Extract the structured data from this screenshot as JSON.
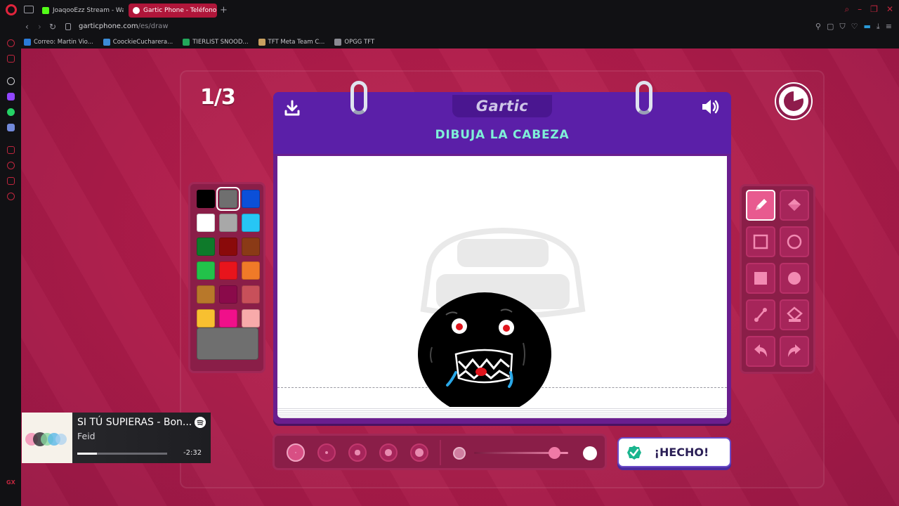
{
  "browser": {
    "tabs": [
      {
        "label": "JoaqooEzz Stream - Watc",
        "active": false,
        "icon": "kick-icon",
        "color": "#53fc18"
      },
      {
        "label": "Gartic Phone - Teléfono D",
        "active": true,
        "icon": "gartic-icon",
        "color": "#e0243c"
      }
    ],
    "url_host": "garticphone.com",
    "url_path": "/es/draw",
    "bookmarks": [
      {
        "label": "Correo: Martin Vio...",
        "icon": "outlook-icon",
        "color": "#2a7ad8"
      },
      {
        "label": "CoockieCucharera...",
        "icon": "bookmark-l-icon",
        "color": "#3b8bd6"
      },
      {
        "label": "TIERLIST SNOOD...",
        "icon": "sheets-icon",
        "color": "#22a65a"
      },
      {
        "label": "TFT Meta Team C...",
        "icon": "tft-icon",
        "color": "#c8a060"
      },
      {
        "label": "OPGG TFT",
        "icon": "opgg-icon",
        "color": "#8a8a92"
      }
    ],
    "accent": "#e0243c"
  },
  "game": {
    "round": "1/3",
    "logo": "Gartic",
    "instruction": "DIBUJA LA CABEZA",
    "colors": {
      "background": "#b01c4a",
      "notebook_header": "#5b1fa8",
      "instruction": "#7ff0d8",
      "panel": "#8a1e48"
    },
    "palette": [
      "#000000",
      "#6f6f6f",
      "#0b4fd8",
      "#ffffff",
      "#a8a8a8",
      "#27c6f5",
      "#0e7a2a",
      "#8a0a0a",
      "#8a3a16",
      "#22c24a",
      "#e8141c",
      "#f07a28",
      "#b8782a",
      "#8a0a4a",
      "#c8505a",
      "#f8c030",
      "#f0108a",
      "#f8aaaa"
    ],
    "selected_color_index": 1,
    "current_color": "#6f6f6f",
    "tools": [
      "pencil-tool-icon",
      "fill-bucket-icon",
      "outline-rectangle-icon",
      "outline-ellipse-icon",
      "filled-rectangle-icon",
      "filled-ellipse-icon",
      "line-tool-icon",
      "fill-all-icon",
      "undo-icon",
      "redo-icon"
    ],
    "active_tool": 0,
    "brush_sizes": [
      2,
      4,
      6,
      8,
      10
    ],
    "active_size": 0,
    "opacity_level": 0.85,
    "done_label": "¡HECHO!",
    "timer_remaining": 0.8
  },
  "spotify": {
    "title": "SI TÚ SUPIERAS - Bon...",
    "artist": "Feid",
    "remaining": "-2:32",
    "progress": 0.22
  }
}
